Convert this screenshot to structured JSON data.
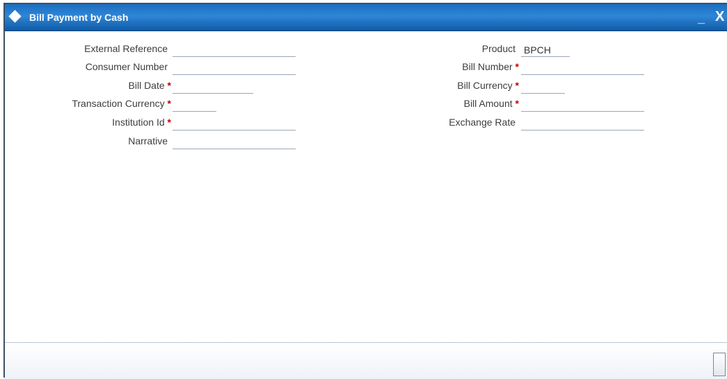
{
  "window": {
    "title": "Bill Payment by Cash",
    "minimize": "_",
    "close": "X"
  },
  "required_marker": "*",
  "left_fields": [
    {
      "label": "External Reference",
      "required": false,
      "value": ""
    },
    {
      "label": "Consumer Number",
      "required": false,
      "value": ""
    },
    {
      "label": "Bill Date",
      "required": true,
      "value": ""
    },
    {
      "label": "Transaction Currency",
      "required": true,
      "value": ""
    },
    {
      "label": "Institution Id",
      "required": true,
      "value": ""
    },
    {
      "label": "Narrative",
      "required": false,
      "value": ""
    }
  ],
  "right_fields": [
    {
      "label": "Product",
      "required": false,
      "value": "BPCH"
    },
    {
      "label": "Bill Number",
      "required": true,
      "value": ""
    },
    {
      "label": "Bill Currency",
      "required": true,
      "value": ""
    },
    {
      "label": "Bill Amount",
      "required": true,
      "value": ""
    },
    {
      "label": "Exchange Rate",
      "required": false,
      "value": ""
    }
  ]
}
